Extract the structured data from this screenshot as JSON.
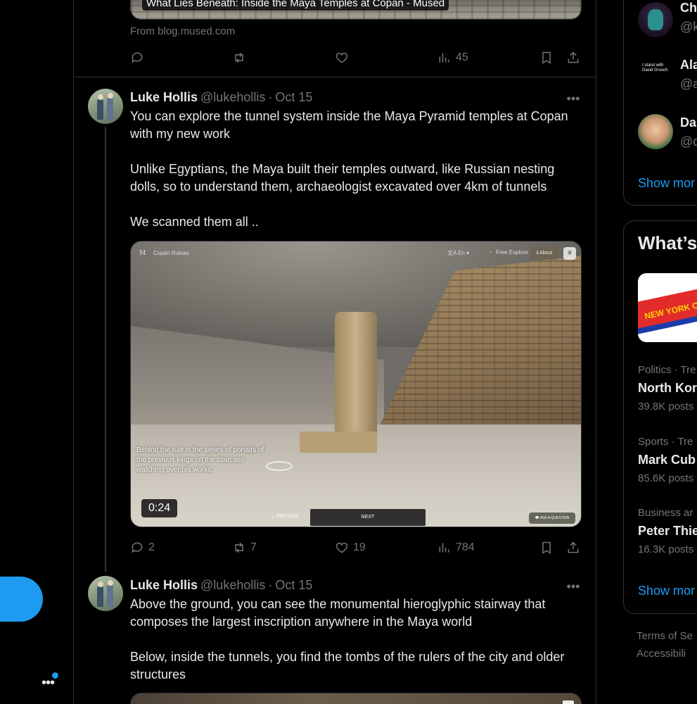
{
  "colors": {
    "accent": "#1d9bf0",
    "background": "#000000",
    "text": "#e7e9ea",
    "muted": "#71767b",
    "border": "#2f3336"
  },
  "previous_tweet": {
    "card_title": "What Lies Beneath: Inside the Maya Temples at Copan - Mused",
    "from_link": "From blog.mused.com",
    "views": "45"
  },
  "tweet1": {
    "name": "Luke Hollis",
    "handle": "@lukehollis",
    "separator": "·",
    "date": "Oct 15",
    "text": "You can explore the tunnel system inside the Maya Pyramid temples at Copan with my new work\n\nUnlike Egyptians, the Maya built their temples outward, like Russian nesting dolls, so to understand them, archaeologist excavated over 4km of tunnels\n\nWe scanned them all ..",
    "video": {
      "logo": "M",
      "site": "Copán Ruinas",
      "lang": "文A  En ▾",
      "explore": "🚶 Free Explore",
      "about": "ℹ About",
      "menu": "≡",
      "caption": "Behind the rule is the series of portaits of\nthe previous kings on the staircase\nwatching over his works.",
      "duration": "0:24",
      "prev": "← PREVIOUS",
      "next": "NEXT",
      "ask": "💬 ASK A QUESTION"
    },
    "replies": "2",
    "reposts": "7",
    "likes": "19",
    "views": "784"
  },
  "tweet2": {
    "name": "Luke Hollis",
    "handle": "@lukehollis",
    "separator": "·",
    "date": "Oct 15",
    "text": "Above the ground, you can see the monumental hieroglyphic stairway that composes the largest inscription anywhere in the Maya world\n\nBelow, inside the tunnels, you find the tombs of the rulers of the city and older structures"
  },
  "who_to_follow": {
    "items": [
      {
        "name": "Ch",
        "handle": "@k"
      },
      {
        "name": "Ala",
        "handle": "@a",
        "avatar_text": "I stand with David Grusch."
      },
      {
        "name": "Da",
        "handle": "@d"
      }
    ],
    "show_more": "Show mor"
  },
  "happening": {
    "title": "What’s",
    "event_image_text": "NEW YORK COMIC CON",
    "trends": [
      {
        "meta": "Politics · Tre",
        "title": "North Kor",
        "count": "39.8K posts"
      },
      {
        "meta": "Sports · Tre",
        "title": "Mark Cub",
        "count": "85.6K posts"
      },
      {
        "meta": "Business ar",
        "title": "Peter Thie",
        "count": "16.3K posts"
      }
    ],
    "show_more": "Show mor"
  },
  "footer": {
    "terms": "Terms of Se",
    "accessibility": "Accessibili"
  },
  "nav": {
    "more": "•••"
  }
}
